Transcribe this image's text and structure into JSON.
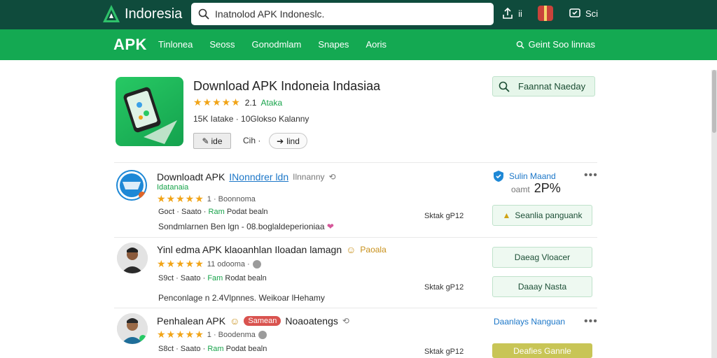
{
  "header": {
    "brand": "Indoresia",
    "search_placeholder": "Inatnolod APK Indoneslc.",
    "actions": [
      {
        "label": "ii",
        "icon": "share-icon"
      },
      {
        "label": "",
        "icon": "gift-icon"
      },
      {
        "label": "Sci",
        "icon": "chat-icon"
      }
    ]
  },
  "nav": {
    "brand": "APK",
    "items": [
      "Tinlonea",
      "Seoss",
      "Gonodmlam",
      "Snapes",
      "Aoris"
    ],
    "right_label": "Geint Soo linnas"
  },
  "hero": {
    "title": "Download APK Indoneia Indasiaa",
    "stars": "★★★★★",
    "rating": "2.1",
    "rating_label": "Ataka",
    "meta": "15K Iatake · 10Glokso Kalanny",
    "btn_left": "ide",
    "mid_text": "Cih ·",
    "btn_right": "lind",
    "cta": "Faannat Naeday"
  },
  "rows": [
    {
      "title": "Downloadt APK",
      "link": "INonndrer ldn",
      "extra": "Ilnnanny",
      "subtitle": "Idatanaia",
      "stars": "★★★★★",
      "stars_text": "1 · Boonnoma",
      "line_prefix": "Goct · Saato · ",
      "line_green": "Ram",
      "line_suffix": " Podat bealn",
      "desc": "Sondmlarnen Ben lgn - 08.boglaldeperioniaa",
      "size": "Sktak gP12",
      "side_title": "Sulin Maand",
      "side_sub": "oamt",
      "side_percent": "2P%",
      "side_button": "Seanlia panguank"
    },
    {
      "title": "Yinl edma APK klaoanhlan Iloadan lamagn",
      "badge": "Paoala",
      "stars": "★★★★★",
      "stars_text": "11 odooma ·",
      "line_prefix": "S9ct · Saato · ",
      "line_green": "Fam",
      "line_suffix": " Rodat bealn",
      "desc": "Penconlage n 2.4Vlpnnes. Weikoar lHehamy",
      "size": "Sktak gP12",
      "side_button_1": "Daeag Vloacer",
      "side_button_2": "Daaay Nasta"
    },
    {
      "title": "Penhalean APK",
      "badge_red": "Samean",
      "extra": "Noaoatengs",
      "stars": "★★★★★",
      "stars_text": "1 · Boodenma",
      "line_prefix": "S8ct · Saato · ",
      "line_green": "Ram",
      "line_suffix": " Podat bealn",
      "size": "Sktak gP12",
      "side_text": "Daanlays Nanguan",
      "side_button": "Deafies Gannle"
    }
  ],
  "colors": {
    "topbar": "#0f4b3c",
    "navbar": "#14a952",
    "accent_green": "#17a34a",
    "star": "#f1a417"
  }
}
